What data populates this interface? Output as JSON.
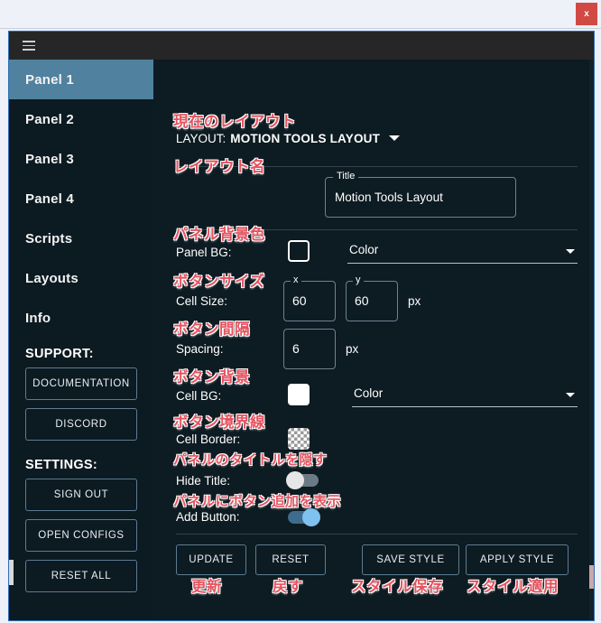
{
  "window": {
    "close_label": "x",
    "close_color": "#d04a43"
  },
  "topbar": {
    "menu_icon": "hamburger-icon"
  },
  "sidebar": {
    "nav_items": [
      {
        "label": "Panel 1",
        "active": true
      },
      {
        "label": "Panel 2",
        "active": false
      },
      {
        "label": "Panel 3",
        "active": false
      },
      {
        "label": "Panel 4",
        "active": false
      },
      {
        "label": "Scripts",
        "active": false
      },
      {
        "label": "Layouts",
        "active": false
      },
      {
        "label": "Info",
        "active": false
      }
    ],
    "support_heading": "SUPPORT:",
    "support_buttons": [
      {
        "label": "DOCUMENTATION"
      },
      {
        "label": "DISCORD"
      }
    ],
    "settings_heading": "SETTINGS:",
    "settings_buttons": [
      {
        "label": "SIGN OUT"
      },
      {
        "label": "OPEN CONFIGS"
      },
      {
        "label": "RESET ALL"
      }
    ],
    "active_color": "#50819e"
  },
  "main": {
    "layout_header": {
      "label": "LAYOUT:",
      "value": "MOTION TOOLS LAYOUT",
      "caret_icon": "chevron-down-icon"
    },
    "title_field": {
      "legend": "Title",
      "value": "Motion Tools Layout"
    },
    "panel_bg": {
      "label": "Panel BG:",
      "swatch_style": "outline",
      "select_value": "Color",
      "caret_icon": "chevron-down-icon"
    },
    "cell_size": {
      "label": "Cell Size:",
      "x_legend": "x",
      "x_value": "60",
      "y_legend": "y",
      "y_value": "60",
      "unit": "px"
    },
    "spacing": {
      "label": "Spacing:",
      "value": "6",
      "unit": "px"
    },
    "cell_bg": {
      "label": "Cell BG:",
      "swatch_style": "white",
      "select_value": "Color",
      "caret_icon": "chevron-down-icon"
    },
    "cell_border": {
      "label": "Cell Border:",
      "swatch_style": "checker"
    },
    "hide_title": {
      "label": "Hide Title:",
      "state": "off"
    },
    "add_button": {
      "label": "Add Button:",
      "state": "on"
    },
    "actions": [
      {
        "label": "UPDATE"
      },
      {
        "label": "RESET"
      },
      {
        "label": "SAVE STYLE"
      },
      {
        "label": "APPLY STYLE"
      }
    ]
  },
  "annotations": {
    "color": "#e4535f",
    "current_layout": "現在のレイアウト",
    "layout_name": "レイアウト名",
    "panel_bg_color": "パネル背景色",
    "button_size": "ボタンサイズ",
    "button_spacing": "ボタン間隔",
    "button_bg": "ボタン背景",
    "button_border": "ボタン境界線",
    "hide_panel_title": "パネルのタイトルを隠す",
    "show_add_button": "パネルにボタン追加を表示",
    "update": "更新",
    "reset": "戻す",
    "save_style": "スタイル保存",
    "apply_style": "スタイル適用"
  }
}
